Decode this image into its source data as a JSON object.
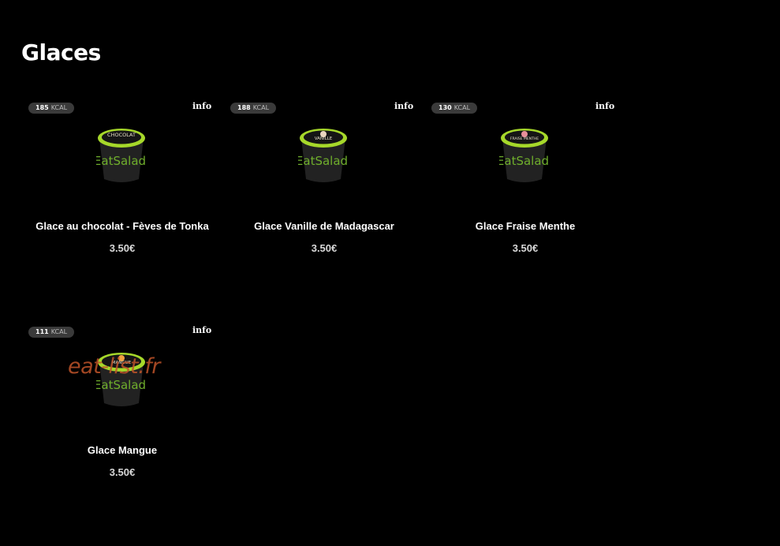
{
  "page": {
    "title": "Glaces"
  },
  "products": [
    {
      "kcal": "185",
      "kcal_unit": "KCAL",
      "info": "info",
      "tub_label": "CHOCOLAT",
      "brand": "EatSalad",
      "name": "Glace au chocolat - Fèves de Tonka",
      "price": "3.50€"
    },
    {
      "kcal": "188",
      "kcal_unit": "KCAL",
      "info": "info",
      "tub_label": "VANILLE",
      "brand": "EatSalad",
      "name": "Glace Vanille de Madagascar",
      "price": "3.50€"
    },
    {
      "kcal": "130",
      "kcal_unit": "KCAL",
      "info": "info",
      "tub_label": "FRAISE MENTHE",
      "brand": "EatSalad",
      "name": "Glace Fraise Menthe",
      "price": "3.50€"
    },
    {
      "kcal": "111",
      "kcal_unit": "KCAL",
      "info": "info",
      "tub_label": "MANGUE",
      "brand": "EatSalad",
      "name": "Glace Mangue",
      "price": "3.50€"
    }
  ],
  "watermark": "eat-list.fr",
  "colors": {
    "background": "#000000",
    "tub_rim": "#a6d82a",
    "badge": "#3a3a3a",
    "watermark": "#c0542a"
  }
}
